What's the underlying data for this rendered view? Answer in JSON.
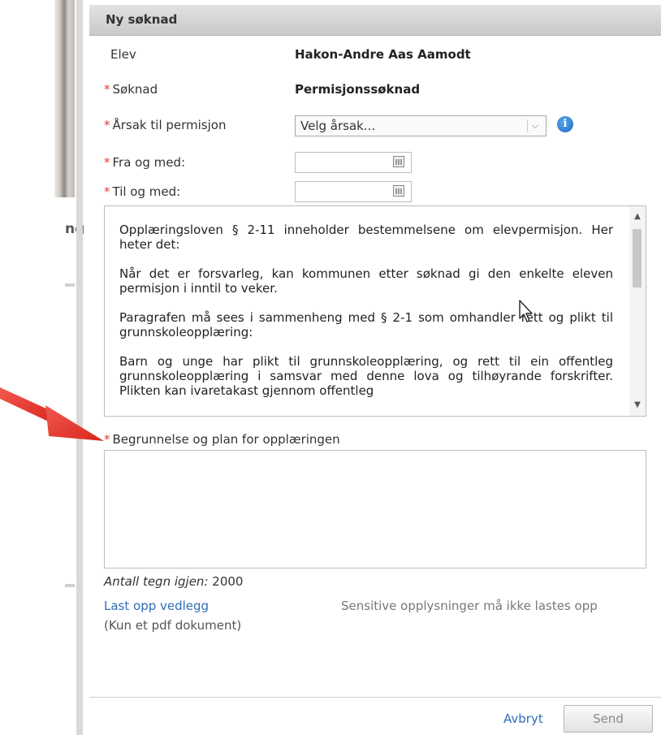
{
  "background": {
    "fragment_text": "ng"
  },
  "dialog": {
    "title": "Ny søknad",
    "fields": {
      "student_label": "Elev",
      "student_value": "Hakon-Andre Aas Aamodt",
      "application_label": "Søknad",
      "application_value": "Permisjonssøknad",
      "reason_label": "Årsak til permisjon",
      "reason_select_value": "Velg årsak...",
      "from_label": "Fra og med:",
      "from_value": "",
      "to_label": "Til og med:",
      "to_value": ""
    },
    "required_marker": "*",
    "info_text": [
      "Opplæringsloven § 2-11 inneholder bestemmelsene om elevpermisjon. Her heter det:",
      "Når det er forsvarleg, kan kommunen etter søknad gi den enkelte eleven permisjon i inntil to veker.",
      "Paragrafen må sees i sammenheng med § 2-1 som omhandler rett og plikt til grunnskoleopplæring:",
      "Barn og unge har plikt til grunnskoleopplæring, og rett til ein offentleg grunnskoleopplæring i samsvar med denne lova og tilhøyrande forskrifter. Plikten kan ivaretakast gjennom offentleg"
    ],
    "justification_label": "Begrunnelse og plan for opplæringen",
    "justification_value": "",
    "chars_left_label": "Antall tegn igjen:",
    "chars_left_value": "2000",
    "upload_link": "Last opp vedlegg",
    "upload_note": "(Kun et pdf dokument)",
    "sensitive_note": "Sensitive opplysninger må ikke lastes opp",
    "cancel_label": "Avbryt",
    "send_label": "Send"
  },
  "colors": {
    "required": "#e23a3a",
    "link": "#2f6db5",
    "arrow": "#e8392f",
    "info_icon": "#1e6fc5"
  }
}
